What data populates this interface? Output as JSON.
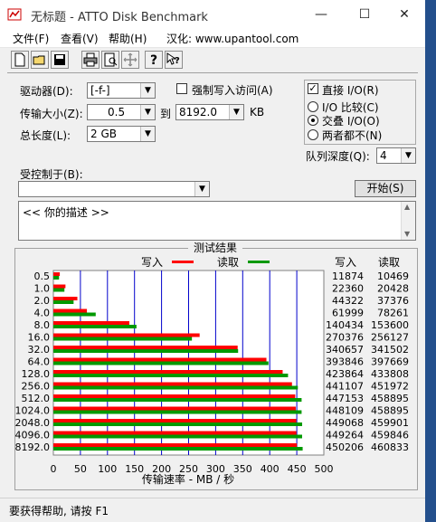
{
  "window": {
    "title": "无标题 - ATTO Disk Benchmark",
    "controls": {
      "minimize": "—",
      "maximize": "☐",
      "close": "✕"
    }
  },
  "menu": [
    "文件(F)",
    "查看(V)",
    "帮助(H)",
    "汉化: www.upantool.com"
  ],
  "toolbar": [
    "new-icon",
    "open-icon",
    "save-icon",
    "print-icon",
    "print-preview-icon",
    "move-icon",
    "help-icon",
    "context-help-icon"
  ],
  "settings": {
    "drive_label": "驱动器(D):",
    "drive_value": "[-f-]",
    "force_write_label": "强制写入访问(A)",
    "force_write_checked": false,
    "transfer_size_label": "传输大小(Z):",
    "transfer_from": "0.5",
    "transfer_to_label": "到",
    "transfer_to": "8192.0",
    "transfer_unit": "KB",
    "total_length_label": "总长度(L):",
    "total_length_value": "2 GB",
    "direct_io_label": "直接 I/O(R)",
    "direct_io_checked": true,
    "io_options": [
      {
        "label": "I/O 比较(C)",
        "selected": false
      },
      {
        "label": "交叠 I/O(O)",
        "selected": true
      },
      {
        "label": "两者都不(N)",
        "selected": false
      }
    ],
    "queue_depth_label": "队列深度(Q):",
    "queue_depth_value": "4",
    "controlled_by_label": "受控制于(B):",
    "controlled_by_value": "",
    "start_button": "开始(S)",
    "description": "<<  你的描述    >>"
  },
  "results": {
    "frame_title": "测试结果",
    "legend_write": "写入",
    "legend_read": "读取",
    "col_write": "写入",
    "col_read": "读取",
    "write_color": "#ff0000",
    "read_color": "#009900",
    "grid_color": "#0000cc"
  },
  "chart_data": {
    "type": "bar",
    "orientation": "horizontal",
    "categories": [
      "0.5",
      "1.0",
      "2.0",
      "4.0",
      "8.0",
      "16.0",
      "32.0",
      "64.0",
      "128.0",
      "256.0",
      "512.0",
      "1024.0",
      "2048.0",
      "4096.0",
      "8192.0"
    ],
    "series": [
      {
        "name": "写入",
        "values": [
          11874,
          22360,
          44322,
          61999,
          140434,
          270376,
          340657,
          393846,
          423864,
          441107,
          447153,
          448109,
          449068,
          449264,
          450206
        ]
      },
      {
        "name": "读取",
        "values": [
          10469,
          20428,
          37376,
          78261,
          153600,
          256127,
          341502,
          397669,
          433808,
          451972,
          458895,
          458895,
          459901,
          459846,
          460833
        ]
      }
    ],
    "xlabel": "传输速率 - MB / 秒",
    "xticks": [
      "0",
      "50",
      "100",
      "150",
      "200",
      "250",
      "300",
      "350",
      "400",
      "450",
      "500"
    ],
    "xlim": [
      0,
      500
    ],
    "value_unit_divisor": 1000,
    "grid": true,
    "legend": "top"
  },
  "status_text": "要获得帮助, 请按 F1"
}
